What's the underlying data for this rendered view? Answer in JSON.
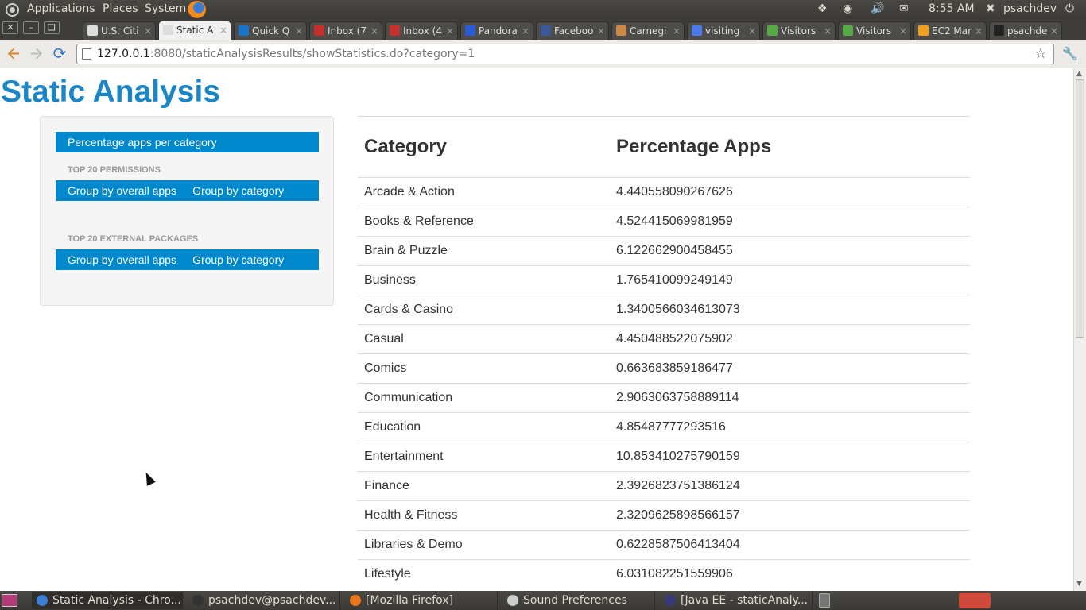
{
  "top_panel": {
    "menus": [
      "Applications",
      "Places",
      "System"
    ],
    "clock": "8:55 AM",
    "user": "psachdev"
  },
  "tabs": [
    {
      "label": "U.S. Citi",
      "icon": "page-icon",
      "active": false
    },
    {
      "label": "Static A",
      "icon": "page-icon",
      "active": true
    },
    {
      "label": "Quick Q",
      "icon": "quick-icon",
      "active": false
    },
    {
      "label": "Inbox (7",
      "icon": "gmail-icon",
      "active": false
    },
    {
      "label": "Inbox (4",
      "icon": "gmail-icon",
      "active": false
    },
    {
      "label": "Pandora",
      "icon": "pandora-icon",
      "active": false
    },
    {
      "label": "Faceboo",
      "icon": "facebook-icon",
      "active": false
    },
    {
      "label": "Carnegi",
      "icon": "mail-icon",
      "active": false
    },
    {
      "label": "visiting",
      "icon": "google-icon",
      "active": false
    },
    {
      "label": "Visitors",
      "icon": "leaf-icon",
      "active": false
    },
    {
      "label": "Visitors",
      "icon": "leaf-icon",
      "active": false
    },
    {
      "label": "EC2 Mar",
      "icon": "ec2-icon",
      "active": false
    },
    {
      "label": "psachde",
      "icon": "github-icon",
      "active": false
    }
  ],
  "address_bar": {
    "host": "127.0.0.1",
    "rest": ":8080/staticAnalysisResults/showStatistics.do?category=1"
  },
  "page": {
    "title": "Static Analysis",
    "sidebar": {
      "main_link": "Percentage apps per category",
      "permissions_header": "TOP 20 PERMISSIONS",
      "permissions_links": [
        "Group by overall apps",
        "Group by category"
      ],
      "packages_header": "TOP 20 EXTERNAL PACKAGES",
      "packages_links": [
        "Group by overall apps",
        "Group by category"
      ]
    },
    "table": {
      "headers": [
        "Category",
        "Percentage Apps"
      ],
      "rows": [
        [
          "Arcade & Action",
          "4.440558090267626"
        ],
        [
          "Books & Reference",
          "4.524415069981959"
        ],
        [
          "Brain & Puzzle",
          "6.122662900458455"
        ],
        [
          "Business",
          "1.765410099249149"
        ],
        [
          "Cards & Casino",
          "1.3400566034613073"
        ],
        [
          "Casual",
          "4.450488522075902"
        ],
        [
          "Comics",
          "0.663683859186477"
        ],
        [
          "Communication",
          "2.9063063758889114"
        ],
        [
          "Education",
          "4.85487777293516"
        ],
        [
          "Entertainment",
          "10.853410275790159"
        ],
        [
          "Finance",
          "2.3926823751386124"
        ],
        [
          "Health & Fitness",
          "2.3209625898566157"
        ],
        [
          "Libraries & Demo",
          "0.6228587506413404"
        ],
        [
          "Lifestyle",
          "6.031082251559906"
        ]
      ]
    }
  },
  "taskbar": [
    {
      "label": "Static Analysis - Chro...",
      "icon": "chrome-icon",
      "color": "#3b7dd8"
    },
    {
      "label": "psachdev@psachdev...",
      "icon": "terminal-icon",
      "color": "#333333"
    },
    {
      "label": "[Mozilla Firefox]",
      "icon": "firefox-icon",
      "color": "#e8761c"
    },
    {
      "label": "Sound Preferences",
      "icon": "sound-icon",
      "color": "#cccccc"
    },
    {
      "label": "[Java EE - staticAnaly...",
      "icon": "eclipse-icon",
      "color": "#3a3a7a"
    }
  ]
}
